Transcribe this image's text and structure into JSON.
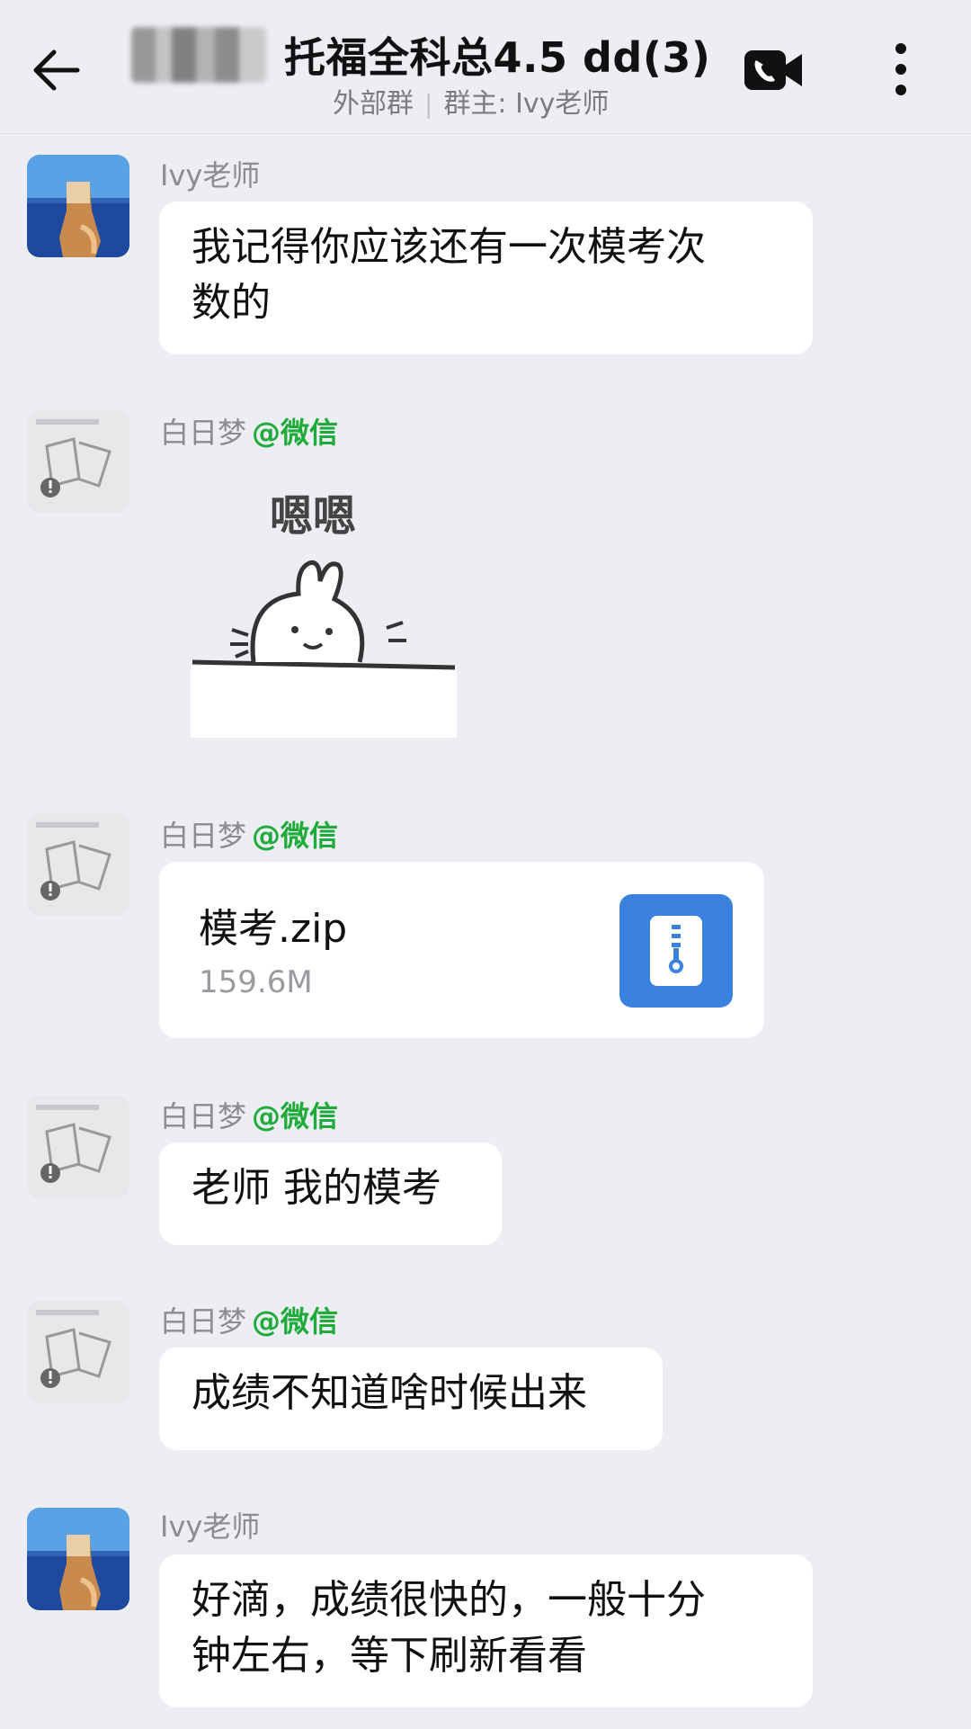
{
  "header": {
    "title": "托福全科总4.5 dd(3)",
    "group_type": "外部群",
    "separator": "|",
    "owner": "群主: Ivy老师",
    "icons": {
      "back": "arrow-left-icon",
      "video": "video-call-icon",
      "more": "more-vertical-icon"
    }
  },
  "messages": [
    {
      "sender": "Ivy老师",
      "text_line1": "我记得你应该还有一次模考次",
      "text_line2": "数的"
    },
    {
      "sender": "白日梦",
      "tag": "@微信",
      "sticker_text": "嗯嗯"
    },
    {
      "sender": "白日梦",
      "tag": "@微信",
      "file_name": "模考.zip",
      "file_size": "159.6M"
    },
    {
      "sender": "白日梦",
      "tag": "@微信",
      "text": "老师 我的模考"
    },
    {
      "sender": "白日梦",
      "tag": "@微信",
      "text": "成绩不知道啥时候出来"
    },
    {
      "sender": "Ivy老师",
      "text_line1": "好滴，成绩很快的，一般十分",
      "text_line2": "钟左右，等下刷新看看"
    }
  ],
  "colors": {
    "background": "#EDEEF3",
    "bubble": "#FFFFFF",
    "tag_green": "#1FAB3A",
    "file_icon_blue": "#3B82E0"
  }
}
